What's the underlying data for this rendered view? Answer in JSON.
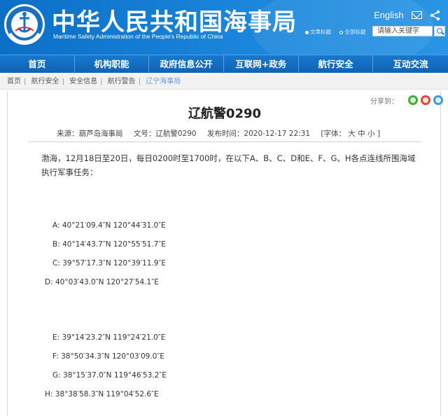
{
  "header": {
    "title": "中华人民共和国海事局",
    "subtitle": "Maritime Safety Administration of the People's Republic of China",
    "logo_text": "CHINA MSA",
    "english_link": "English",
    "search_scope": [
      "文章标题",
      "全部标题"
    ],
    "search_placeholder": "请输入关键字",
    "brand_color": "#1479cc"
  },
  "nav": [
    "首页",
    "机构职能",
    "政府信息公开",
    "互联网+政务",
    "航行安全",
    "互动交流"
  ],
  "breadcrumb": [
    "首页",
    "航行安全",
    "安全信息",
    "航行警告",
    "辽宁海事局"
  ],
  "article": {
    "share_label": "分享到：",
    "title": "辽航警0290",
    "source": "来源：葫芦岛海事局",
    "doc_no": "文号：辽航警0290",
    "published": "发布时间：2020-12-17 22:31",
    "font_size": "[字体： 大  中  小 ]",
    "intro": "渤海，12月18日至20日，每日0200时至1700时，在以下A、B、C、D和E、F、G、H各点连线所围海域执行军事任务：",
    "coords": [
      "A: 40°21′09.4″N 120°44′31.0″E",
      "B: 40°14′43.7″N 120°55′51.7″E",
      "C: 39°57′17.3″N 120°39′11.9″E",
      "D: 40°03′43.0″N 120°27′54.1″E",
      "E: 39°14′23.2″N 119°24′21.0″E",
      "F: 38°50′34.3″N 120°03′09.0″E",
      "G: 38°15′37.0″N 119°46′53.2″E",
      "H: 38°38′58.3″N 119°04′52.6″E"
    ]
  }
}
